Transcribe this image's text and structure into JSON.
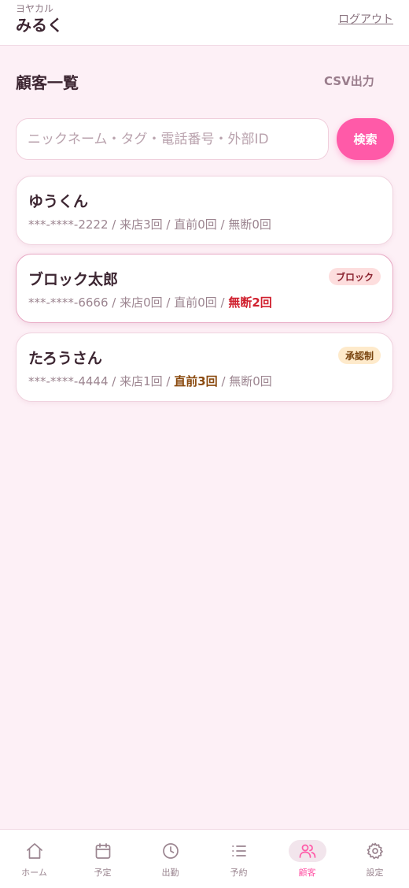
{
  "header": {
    "app_sub": "ヨヤカル",
    "app_title": "みるく",
    "logout_label": "ログアウト"
  },
  "main": {
    "title": "顧客一覧",
    "csv_label": "CSV出力",
    "search": {
      "placeholder": "ニックネーム・タグ・電話番号・外部ID",
      "value": "",
      "button_label": "検索"
    },
    "customers": [
      {
        "name": "ゆうくん",
        "phone": "***-****-2222",
        "visits": "来店3回",
        "last_minute": "直前0回",
        "no_show": "無断0回",
        "badge": ""
      },
      {
        "name": "ブロック太郎",
        "phone": "***-****-6666",
        "visits": "来店0回",
        "last_minute": "直前0回",
        "no_show": "無断2回",
        "badge": "ブロック"
      },
      {
        "name": "たろうさん",
        "phone": "***-****-4444",
        "visits": "来店1回",
        "last_minute": "直前3回",
        "no_show": "無断0回",
        "badge": "承認制"
      }
    ],
    "separator": " / "
  },
  "nav": {
    "items": [
      {
        "label": "ホーム",
        "icon": "home-icon"
      },
      {
        "label": "予定",
        "icon": "calendar-icon"
      },
      {
        "label": "出勤",
        "icon": "clock-icon"
      },
      {
        "label": "予約",
        "icon": "list-icon"
      },
      {
        "label": "顧客",
        "icon": "users-icon"
      },
      {
        "label": "設定",
        "icon": "gear-icon"
      }
    ],
    "active_index": 4
  },
  "colors": {
    "accent": "#ff5aa8",
    "background": "#fdf0f6",
    "warning_red": "#d0202e",
    "warning_brown": "#8a4a0f"
  }
}
